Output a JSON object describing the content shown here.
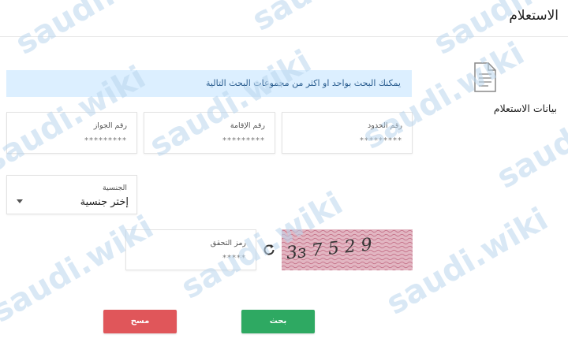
{
  "page": {
    "title": "الاستعلام"
  },
  "info": {
    "message": "يمكنك البحث بواحد او اكثر من مجموعات البحث التالية"
  },
  "section": {
    "label": "بيانات الاستعلام"
  },
  "fields": {
    "border_number": {
      "label": "رقم الحدود",
      "value": "*********"
    },
    "iqama_number": {
      "label": "رقم الإقامة",
      "value": "*********"
    },
    "passport_number": {
      "label": "رقم الجواز",
      "value": "*********"
    },
    "nationality": {
      "label": "الجنسية",
      "value": "إختر جنسية"
    },
    "captcha_code": {
      "label": "رمز التحقق",
      "value": "*****"
    }
  },
  "captcha": {
    "text": "3ɜ 7 5 2 9"
  },
  "buttons": {
    "search": "بحث",
    "clear": "مسح"
  },
  "watermark": {
    "text": "saudi.wiki"
  },
  "colors": {
    "banner_bg": "#dcefff",
    "search_button": "#2ea962",
    "clear_button": "#e0565a",
    "captcha_bg": "#d7a0b0"
  }
}
